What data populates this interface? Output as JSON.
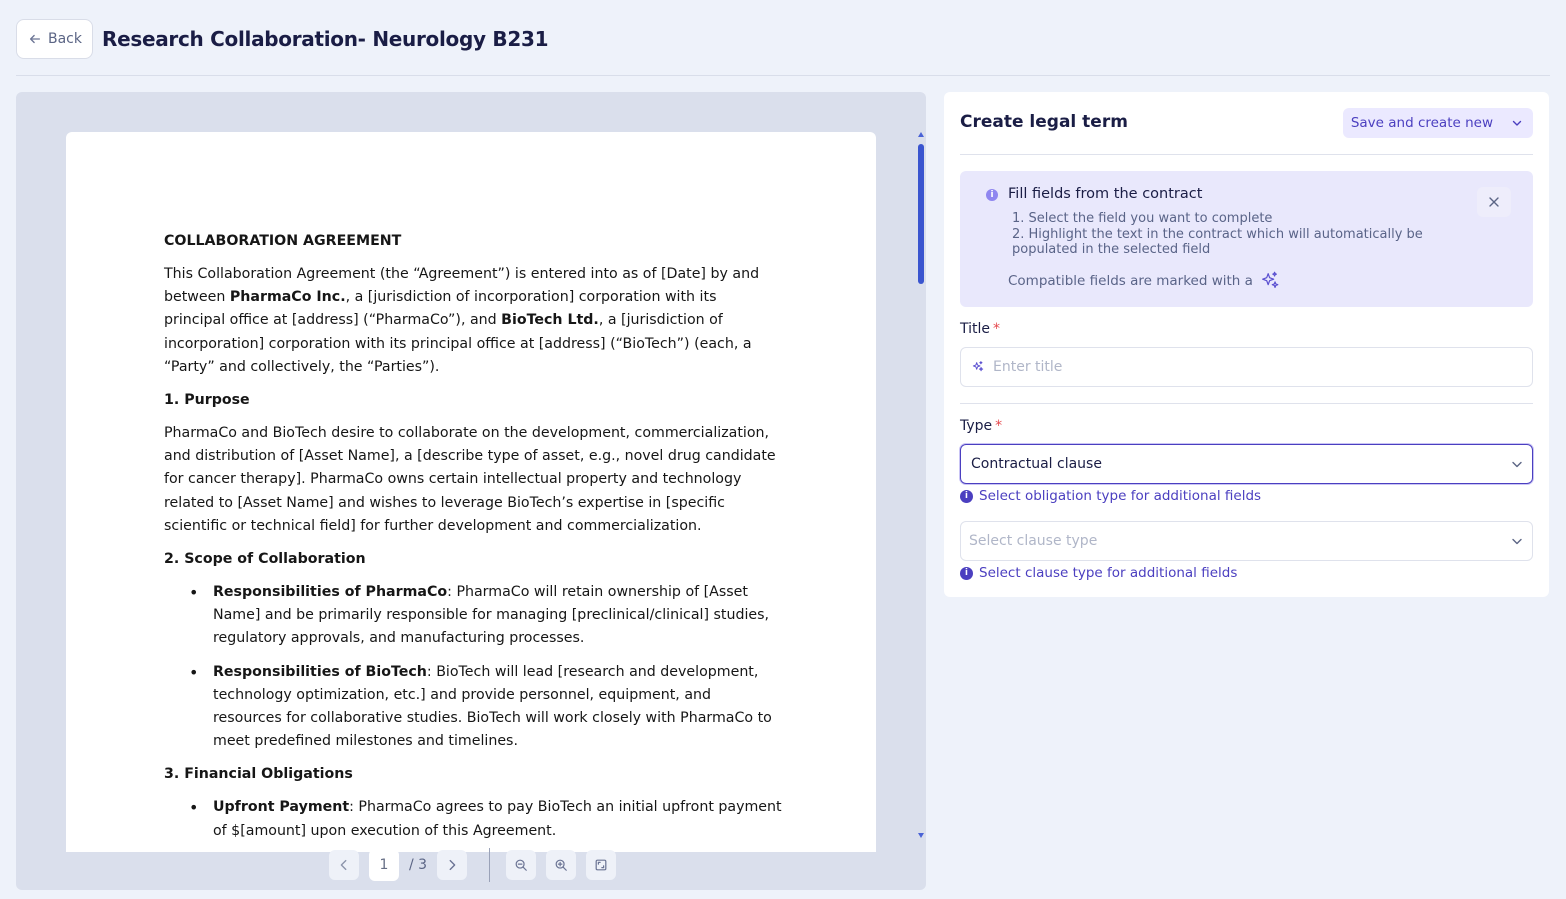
{
  "header": {
    "back_label": "Back",
    "title": "Research Collaboration- Neurology B231"
  },
  "document": {
    "heading": "COLLABORATION AGREEMENT",
    "intro": {
      "p1": "This Collaboration Agreement (the “Agreement”) is entered into as of [Date] by and between ",
      "party1": "PharmaCo Inc.",
      "p2": ", a [jurisdiction of incorporation] corporation with its principal office at [address] (“PharmaCo”), and ",
      "party2": "BioTech Ltd.",
      "p3": ", a [jurisdiction of incorporation] corporation with its principal office at [address] (“BioTech”) (each, a “Party” and collectively, the “Parties”)."
    },
    "section1_title": "1. Purpose",
    "section1_text": "PharmaCo and BioTech desire to collaborate on the development, commercialization, and distribution of [Asset Name], a [describe type of asset, e.g., novel drug candidate for cancer therapy]. PharmaCo owns certain intellectual property and technology related to [Asset Name] and wishes to leverage BioTech’s expertise in [specific scientific or technical field] for further development and commercialization.",
    "section2_title": "2. Scope of Collaboration",
    "section2_items": [
      {
        "label": "Responsibilities of PharmaCo",
        "text": ": PharmaCo will retain ownership of [Asset Name] and be primarily responsible for managing [preclinical/clinical] studies, regulatory approvals, and manufacturing processes."
      },
      {
        "label": "Responsibilities of BioTech",
        "text": ": BioTech will lead [research and development, technology optimization, etc.] and provide personnel, equipment, and resources for collaborative studies. BioTech will work closely with PharmaCo to meet predefined milestones and timelines."
      }
    ],
    "section3_title": "3. Financial Obligations",
    "section3_items": [
      {
        "label": "Upfront Payment",
        "text": ": PharmaCo agrees to pay BioTech an initial upfront payment of $[amount] upon execution of this Agreement."
      }
    ]
  },
  "pager": {
    "current_page": "1",
    "total_pages": "/ 3"
  },
  "panel": {
    "title": "Create legal term",
    "save_label": "Save and create new",
    "info": {
      "heading": "Fill fields from the contract",
      "step1": "1. Select the field you want to complete",
      "step2": "2. Highlight the text in the contract which will automatically be populated in the selected field",
      "compat": "Compatible fields are marked with a"
    },
    "title_field": {
      "label": "Title",
      "required_mark": "*",
      "placeholder": "Enter title"
    },
    "type_field": {
      "label": "Type",
      "required_mark": "*",
      "value": "Contractual clause",
      "hint": "Select obligation type for additional fields"
    },
    "clause_field": {
      "placeholder": "Select clause type",
      "hint": "Select clause type for additional fields"
    }
  },
  "icons": {
    "back": "arrow-left-icon",
    "sparkle": "sparkle-icon",
    "chevron": "chevron-down-icon",
    "close": "close-icon",
    "info": "info-icon"
  },
  "colors": {
    "accent": "#4b3fc0",
    "info_bg": "#e9e8fc",
    "page_bg": "#eef2fa",
    "viewer_bg": "#dadfec",
    "required": "#e5484d"
  }
}
